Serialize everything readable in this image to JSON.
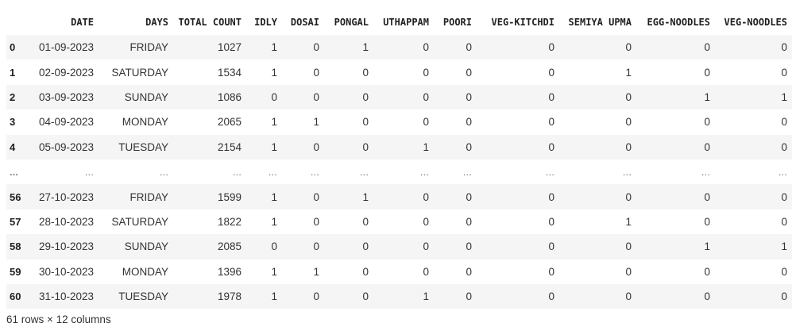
{
  "dataframe": {
    "columns": [
      "",
      "DATE",
      "DAYS",
      "TOTAL COUNT",
      "IDLY",
      "DOSAI",
      "PONGAL",
      "UTHAPPAM",
      "POORI",
      "VEG-KITCHDI",
      "SEMIYA UPMA",
      "EGG-NOODLES",
      "VEG-NOODLES"
    ],
    "rows": [
      {
        "index": "0",
        "cells": [
          "01-09-2023",
          "FRIDAY",
          "1027",
          "1",
          "0",
          "1",
          "0",
          "0",
          "0",
          "0",
          "0",
          "0"
        ]
      },
      {
        "index": "1",
        "cells": [
          "02-09-2023",
          "SATURDAY",
          "1534",
          "1",
          "0",
          "0",
          "0",
          "0",
          "0",
          "1",
          "0",
          "0"
        ]
      },
      {
        "index": "2",
        "cells": [
          "03-09-2023",
          "SUNDAY",
          "1086",
          "0",
          "0",
          "0",
          "0",
          "0",
          "0",
          "0",
          "1",
          "1"
        ]
      },
      {
        "index": "3",
        "cells": [
          "04-09-2023",
          "MONDAY",
          "2065",
          "1",
          "1",
          "0",
          "0",
          "0",
          "0",
          "0",
          "0",
          "0"
        ]
      },
      {
        "index": "4",
        "cells": [
          "05-09-2023",
          "TUESDAY",
          "2154",
          "1",
          "0",
          "0",
          "1",
          "0",
          "0",
          "0",
          "0",
          "0"
        ]
      },
      {
        "index": "...",
        "cells": [
          "...",
          "...",
          "...",
          "...",
          "...",
          "...",
          "...",
          "...",
          "...",
          "...",
          "...",
          "..."
        ]
      },
      {
        "index": "56",
        "cells": [
          "27-10-2023",
          "FRIDAY",
          "1599",
          "1",
          "0",
          "1",
          "0",
          "0",
          "0",
          "0",
          "0",
          "0"
        ]
      },
      {
        "index": "57",
        "cells": [
          "28-10-2023",
          "SATURDAY",
          "1822",
          "1",
          "0",
          "0",
          "0",
          "0",
          "0",
          "1",
          "0",
          "0"
        ]
      },
      {
        "index": "58",
        "cells": [
          "29-10-2023",
          "SUNDAY",
          "2085",
          "0",
          "0",
          "0",
          "0",
          "0",
          "0",
          "0",
          "1",
          "1"
        ]
      },
      {
        "index": "59",
        "cells": [
          "30-10-2023",
          "MONDAY",
          "1396",
          "1",
          "1",
          "0",
          "0",
          "0",
          "0",
          "0",
          "0",
          "0"
        ]
      },
      {
        "index": "60",
        "cells": [
          "31-10-2023",
          "TUESDAY",
          "1978",
          "1",
          "0",
          "0",
          "1",
          "0",
          "0",
          "0",
          "0",
          "0"
        ]
      }
    ],
    "shape_note": "61 rows × 12 columns"
  },
  "colors": {
    "stripe": "#f5f5f5",
    "text": "#212121"
  }
}
